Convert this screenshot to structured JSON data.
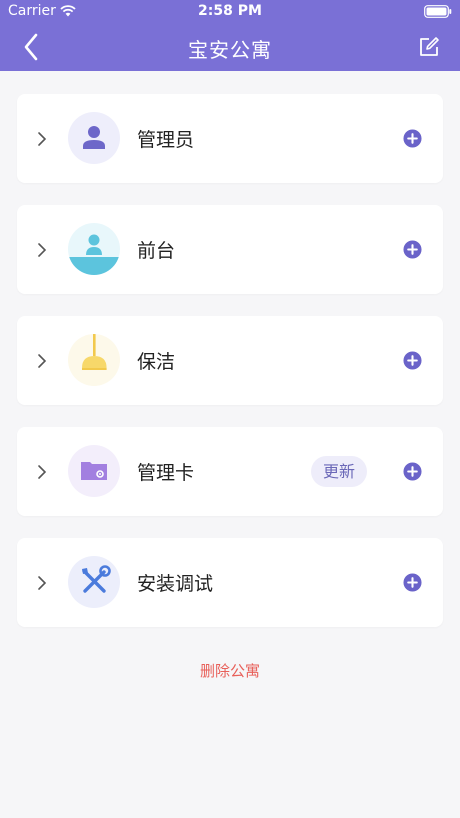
{
  "status_bar": {
    "carrier": "Carrier",
    "time": "2:58 PM"
  },
  "nav": {
    "title": "宝安公寓",
    "back_icon": "chevron-left-icon",
    "edit_icon": "edit-icon"
  },
  "colors": {
    "header": "#7a70d6",
    "accent": "#6a63c9",
    "danger": "#e8605a"
  },
  "sections": [
    {
      "label": "管理员",
      "icon": "person-icon"
    },
    {
      "label": "前台",
      "icon": "reception-icon"
    },
    {
      "label": "保洁",
      "icon": "cleaning-icon"
    },
    {
      "label": "管理卡",
      "icon": "card-icon",
      "action_label": "更新"
    },
    {
      "label": "安装调试",
      "icon": "tools-icon"
    }
  ],
  "footer": {
    "delete_label": "删除公寓"
  }
}
